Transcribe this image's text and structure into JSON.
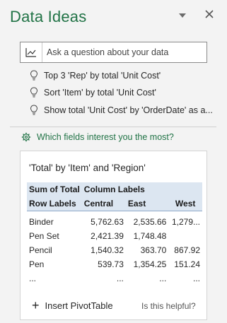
{
  "header": {
    "title": "Data Ideas"
  },
  "ask": {
    "placeholder": "Ask a question about your data",
    "icon": "chart-icon"
  },
  "suggestions": [
    {
      "label": "Top 3 'Rep' by total 'Unit Cost'"
    },
    {
      "label": "Sort 'Item' by total 'Unit Cost'"
    },
    {
      "label": "Show total 'Unit Cost' by 'OrderDate' as a..."
    }
  ],
  "fields_link": {
    "label": "Which fields interest you the most?"
  },
  "card": {
    "title": "'Total' by 'Item' and 'Region'",
    "pivot": {
      "header1": [
        "Sum of Total",
        "Column Labels",
        "",
        ""
      ],
      "header2": [
        "Row Labels",
        "Central",
        "East",
        "West"
      ],
      "rows": [
        [
          "Binder",
          "5,762.63",
          "2,535.66",
          "1,279..."
        ],
        [
          "Pen Set",
          "2,421.39",
          "1,748.48",
          ""
        ],
        [
          "Pencil",
          "1,540.32",
          "363.70",
          "867.92"
        ],
        [
          "Pen",
          "539.73",
          "1,354.25",
          "151.24"
        ],
        [
          "...",
          "...",
          "...",
          "..."
        ]
      ]
    },
    "insert_label": "Insert PivotTable",
    "helpful_label": "Is this helpful?"
  },
  "colors": {
    "accent": "#217346",
    "header_fill": "#dce6f1",
    "background": "#f3f3f3"
  }
}
